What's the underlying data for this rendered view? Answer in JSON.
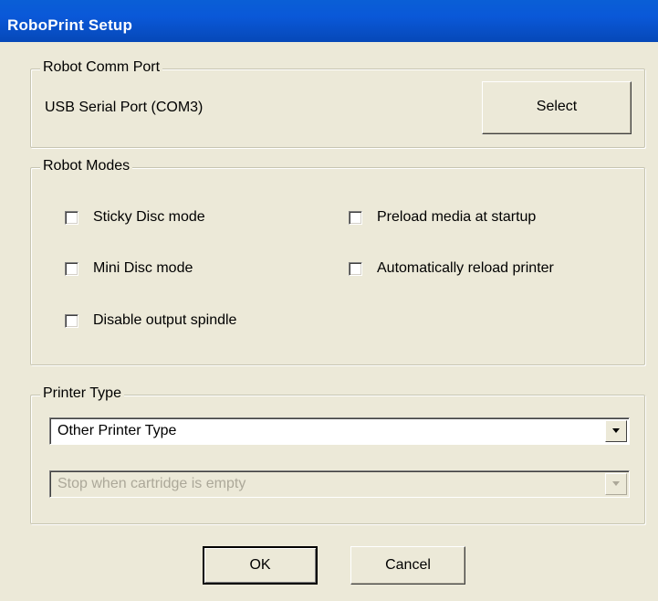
{
  "window": {
    "title": "RoboPrint Setup"
  },
  "comm_port": {
    "legend": "Robot Comm Port",
    "port_value": "USB Serial Port (COM3)",
    "select_label": "Select"
  },
  "modes": {
    "legend": "Robot Modes",
    "options": [
      {
        "label": "Sticky Disc mode",
        "checked": false
      },
      {
        "label": "Mini Disc mode",
        "checked": false
      },
      {
        "label": "Disable output spindle",
        "checked": false
      },
      {
        "label": "Preload media at startup",
        "checked": false
      },
      {
        "label": "Automatically reload printer",
        "checked": false
      }
    ]
  },
  "printer": {
    "legend": "Printer Type",
    "type_selected": "Other Printer Type",
    "cartridge_selected": "Stop when cartridge is empty",
    "cartridge_enabled": false
  },
  "buttons": {
    "ok_label": "OK",
    "cancel_label": "Cancel"
  },
  "icons": {
    "dropdown": "chevron-down-icon"
  },
  "colors": {
    "titlebar": "#0a58d8",
    "dialog_bg": "#ece9d8",
    "disabled_text": "#aca899"
  }
}
